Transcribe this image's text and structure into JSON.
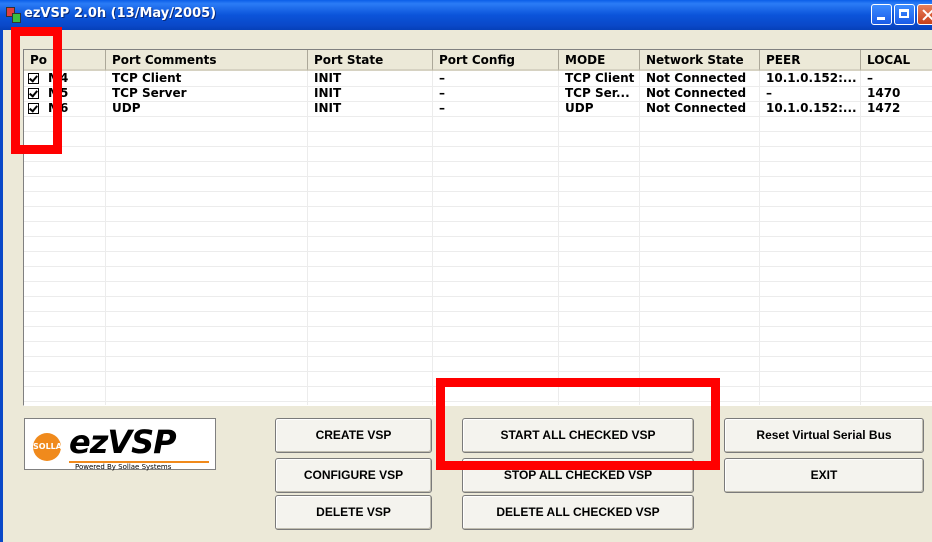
{
  "window": {
    "title": "ezVSP 2.0h (13/May/2005)"
  },
  "listview": {
    "columns": [
      "Po",
      "Port Comments",
      "Port State",
      "Port Config",
      "MODE",
      "Network State",
      "PEER",
      "LOCAL"
    ],
    "rows": [
      {
        "checked": true,
        "port": "M4",
        "comments": "TCP Client",
        "state": "INIT",
        "config": "–",
        "mode": "TCP Client",
        "network": "Not Connected",
        "peer": "10.1.0.152:...",
        "local": "–"
      },
      {
        "checked": true,
        "port": "M5",
        "comments": "TCP Server",
        "state": "INIT",
        "config": "–",
        "mode": "TCP Ser...",
        "network": "Not Connected",
        "peer": "–",
        "local": "1470"
      },
      {
        "checked": true,
        "port": "M6",
        "comments": "UDP",
        "state": "INIT",
        "config": "–",
        "mode": "UDP",
        "network": "Not Connected",
        "peer": "10.1.0.152:...",
        "local": "1472"
      }
    ]
  },
  "logo": {
    "badge": "SOLLAE",
    "word": "ezVSP",
    "tagline": "Powered By Sollae Systems"
  },
  "buttons": {
    "create": "CREATE VSP",
    "configure": "CONFIGURE VSP",
    "delete": "DELETE VSP",
    "start_all": "START ALL CHECKED VSP",
    "stop_all": "STOP ALL CHECKED VSP",
    "delete_all": "DELETE ALL CHECKED VSP",
    "reset": "Reset Virtual Serial Bus",
    "exit": "EXIT"
  },
  "colors": {
    "titlebar": "#0a54da",
    "face": "#ece9d8",
    "highlight": "#ff0000",
    "logo_accent": "#f08a1c"
  }
}
